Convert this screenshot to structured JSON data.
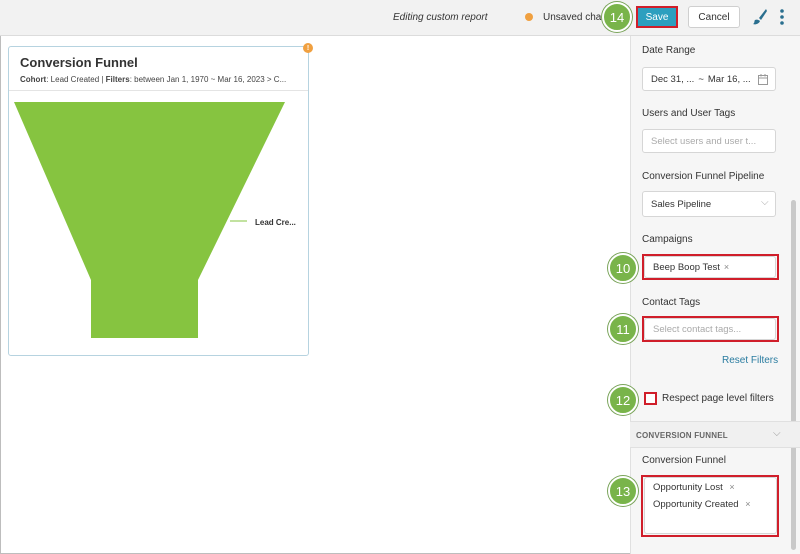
{
  "topbar": {
    "editing_text": "Editing custom report",
    "unsaved_text": "Unsaved changes",
    "save_label": "Save",
    "cancel_label": "Cancel"
  },
  "callouts": [
    "14",
    "10",
    "11",
    "12",
    "13"
  ],
  "card": {
    "title": "Conversion Funnel",
    "cohort_label": "Cohort",
    "cohort_value": ": Lead Created | ",
    "filters_label": "Filters",
    "filters_value": ": between Jan 1, 1970 ~ Mar 16, 2023 > C...",
    "warning_glyph": "!"
  },
  "chart_data": {
    "type": "funnel",
    "stages": [
      {
        "name": "Lead Cre...",
        "color": "#86c440"
      }
    ]
  },
  "panel": {
    "date_range_label": "Date Range",
    "date_start": "Dec 31, ...",
    "date_sep": "~",
    "date_end": "Mar 16, ...",
    "users_label": "Users and User Tags",
    "users_placeholder": "Select users and user t...",
    "pipeline_label": "Conversion Funnel Pipeline",
    "pipeline_value": "Sales Pipeline",
    "campaigns_label": "Campaigns",
    "campaign_tag": "Beep Boop Test",
    "contact_tags_label": "Contact Tags",
    "contact_tags_placeholder": "Select contact tags...",
    "reset_filters": "Reset Filters",
    "respect_filters_label": "Respect page level filters",
    "section_title": "CONVERSION FUNNEL",
    "funnel_label": "Conversion Funnel",
    "funnel_tags": [
      "Opportunity Lost",
      "Opportunity Created"
    ]
  },
  "colors": {
    "accent": "#2c9fbf",
    "funnel": "#86c440",
    "callout": "#79b44a",
    "highlight": "#d01e2a",
    "warning": "#f0a040"
  },
  "icons": {
    "x": "×",
    "chevron": "⌵"
  }
}
